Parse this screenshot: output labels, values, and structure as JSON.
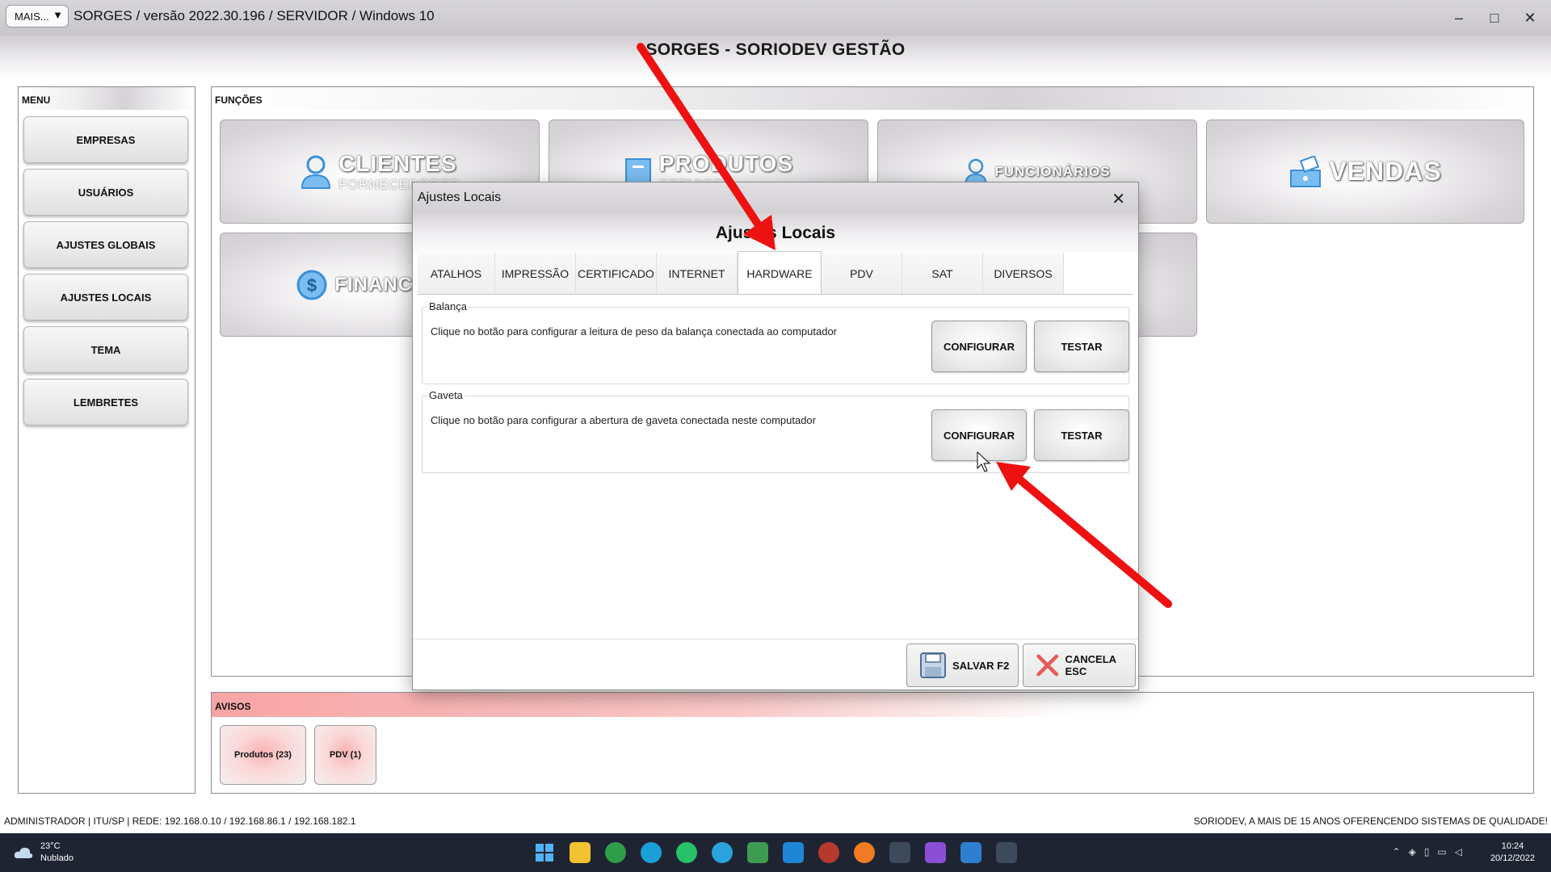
{
  "window": {
    "mais_label": "MAIS...",
    "title": "SORGES / versão 2022.30.196 / SERVIDOR / Windows 10",
    "minimize": "–",
    "maximize": "□",
    "close": "✕"
  },
  "app_title": "SORGES - SORIODEV GESTÃO",
  "menu": {
    "header": "MENU",
    "items": [
      {
        "label": "EMPRESAS"
      },
      {
        "label": "USUÁRIOS"
      },
      {
        "label": "AJUSTES GLOBAIS"
      },
      {
        "label": "AJUSTES LOCAIS"
      },
      {
        "label": "TEMA"
      },
      {
        "label": "LEMBRETES"
      }
    ]
  },
  "functions": {
    "header": "FUNÇÕES",
    "tiles": [
      {
        "label": "CLIENTES",
        "sub": "FORNECEDORES",
        "icon": "person-icon"
      },
      {
        "label": "PRODUTOS",
        "sub": "SERVIÇOS",
        "icon": "box-icon"
      },
      {
        "label": "FUNCIONÁRIOS",
        "icon": "employee-icon"
      },
      {
        "label": "VENDAS",
        "icon": "cash-register-icon"
      },
      {
        "label": "FINANCEIRO",
        "icon": "dollar-icon"
      }
    ]
  },
  "avisos": {
    "header": "AVISOS",
    "items": [
      {
        "label": "Produtos (23)"
      },
      {
        "label": "PDV (1)"
      }
    ]
  },
  "status": {
    "left": "ADMINISTRADOR |   ITU/SP |   REDE: 192.168.0.10 / 192.168.86.1 / 192.168.182.1",
    "right": "SORIODEV, A MAIS DE 15 ANOS OFERENCENDO SISTEMAS DE QUALIDADE!"
  },
  "taskbar": {
    "weather_temp": "23°C",
    "weather_desc": "Nublado",
    "time": "10:24",
    "date": "20/12/2022"
  },
  "dialog": {
    "title": "Ajustes Locais",
    "heading": "Ajustes Locais",
    "close": "✕",
    "tabs": [
      {
        "label": "ATALHOS"
      },
      {
        "label": "IMPRESSÃO"
      },
      {
        "label": "CERTIFICADO"
      },
      {
        "label": "INTERNET"
      },
      {
        "label": "HARDWARE",
        "active": true
      },
      {
        "label": "PDV"
      },
      {
        "label": "SAT"
      },
      {
        "label": "DIVERSOS"
      }
    ],
    "groups": [
      {
        "label": "Balança",
        "text": "Clique no botão para configurar a leitura de peso da balança conectada ao computador",
        "configure": "CONFIGURAR",
        "test": "TESTAR"
      },
      {
        "label": "Gaveta",
        "text": "Clique no botão para configurar a abertura de gaveta conectada neste computador",
        "configure": "CONFIGURAR",
        "test": "TESTAR"
      }
    ],
    "save": "SALVAR F2",
    "cancel": "CANCELA ESC"
  },
  "colors": {
    "annotation_arrow": "#ee1111",
    "taskbar_bg": "#1f2433",
    "avisos_accent": "#f7a4a4"
  }
}
